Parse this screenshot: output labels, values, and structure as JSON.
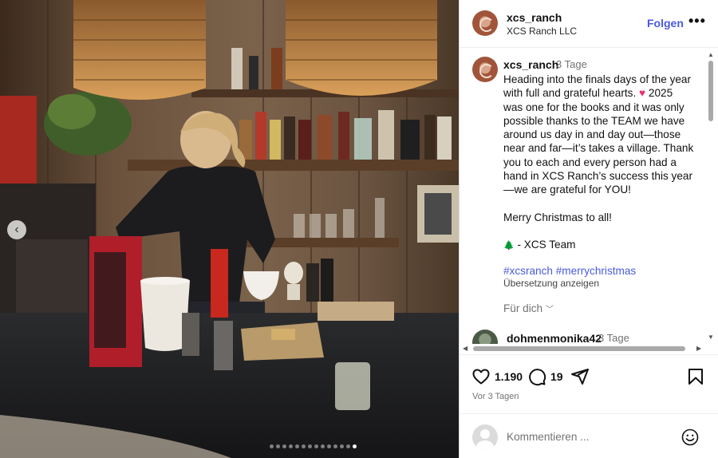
{
  "post": {
    "photo_description_icon": "bar-photo",
    "carousel": {
      "slides": 14,
      "active_index": 13
    }
  },
  "header": {
    "username": "xcs_ranch",
    "subtitle": "XCS Ranch LLC",
    "follow_label": "Folgen",
    "more_label": "•••"
  },
  "caption": {
    "username": "xcs_ranch",
    "time": "3 Tage",
    "line1": "Heading into the finals days of the year with full and grateful hearts.",
    "heart": "♥",
    "line1b": "2025 was one for the books and it was only possible thanks to the TEAM we have around us day in and day out—those near and far—it’s takes a village. Thank you to each and every person had a hand in XCS Ranch’s success this year—we are grateful for YOU!",
    "line2": "Merry Christmas to all!",
    "tree": "🌲",
    "line3": " - XCS Team",
    "hashtag1": "#xcsranch",
    "hashtag2": "#merrychristmas",
    "translate": "Übersetzung anzeigen",
    "for_you": "Für dich"
  },
  "comment2": {
    "username": "dohmenmonika42",
    "time": "3 Tage"
  },
  "actions": {
    "likes": "1.190",
    "comments": "19",
    "posted": "Vor 3 Tagen"
  },
  "add_comment": {
    "placeholder": "Kommentieren ..."
  },
  "colors": {
    "accent": "#4a5bdc",
    "heart": "#e8336b"
  }
}
